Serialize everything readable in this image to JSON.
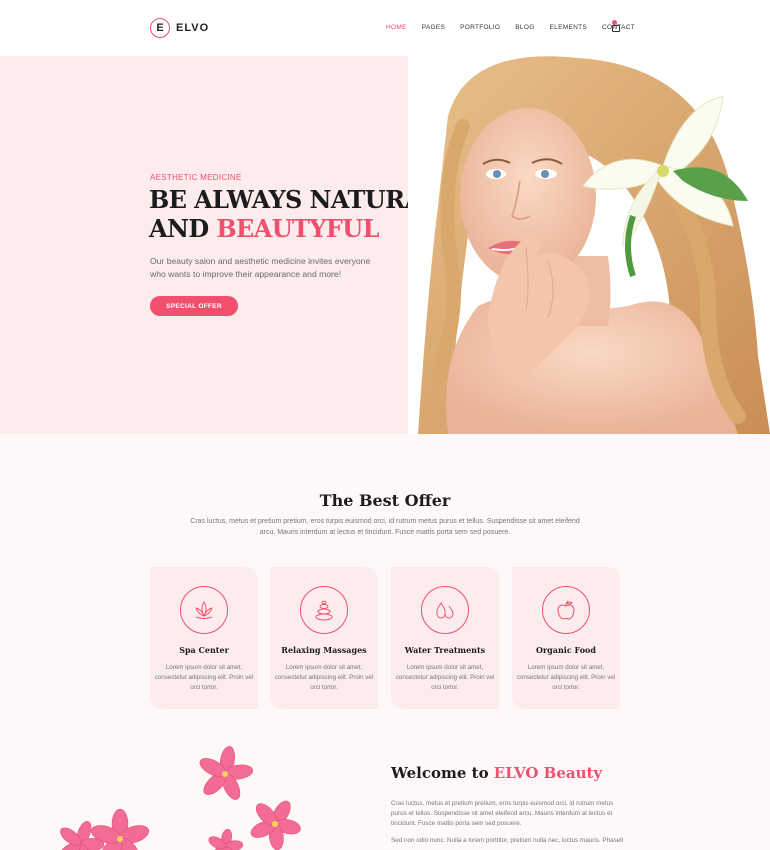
{
  "brand": {
    "logo_letter": "E",
    "name": "ELVO",
    "accent_color": "#f0506e"
  },
  "nav": {
    "items": [
      {
        "label": "HOME",
        "active": true
      },
      {
        "label": "PAGES"
      },
      {
        "label": "PORTFOLIO"
      },
      {
        "label": "BLOG"
      },
      {
        "label": "ELEMENTS"
      },
      {
        "label": "CONTACT"
      }
    ],
    "cart_icon": "shopping-bag-icon"
  },
  "hero": {
    "eyebrow": "AESTHETIC MEDICINE",
    "title_line1": "BE ALWAYS NATURAL",
    "title_line2_plain": "AND ",
    "title_line2_accent": "BEAUTYFUL",
    "description": "Our beauty salon and aesthetic medicine invites everyone who wants to improve their appearance and more!",
    "button_label": "SPECIAL OFFER",
    "image": "woman-with-lily-portrait"
  },
  "offer": {
    "title": "The Best Offer",
    "description": "Cras luctus, metus et pretium pretium, eros turpis euismod orci, id rutrum metus purus et tellus. Suspendisse sit amet eleifend arcu. Mauris interdum at lectus et tincidunt. Fusce mattis porta sem sed posuere.",
    "cards": [
      {
        "title": "Spa Center",
        "icon": "lotus-icon",
        "text": "Lorem ipsum dolor sit amet, consectetur adipiscing elit. Proin vel orci tortor."
      },
      {
        "title": "Relaxing Massages",
        "icon": "stones-icon",
        "text": "Lorem ipsum dolor sit amet, consectetur adipiscing elit. Proin vel orci tortor."
      },
      {
        "title": "Water Treatments",
        "icon": "water-drops-icon",
        "text": "Lorem ipsum dolor sit amet, consectetur adipiscing elit. Proin vel orci tortor."
      },
      {
        "title": "Organic Food",
        "icon": "apple-icon",
        "text": "Lorem ipsum dolor sit amet, consectetur adipiscing elit. Proin vel orci tortor."
      }
    ]
  },
  "welcome": {
    "title_plain": "Welcome to ",
    "title_accent": "ELVO Beauty",
    "paragraph1": "Cras luctus, metus et pretium pretium, eros turpis euismod orci, id rutrum metus purus et tellus. Suspendisse sit amet eleifend arcu. Mauris interdum at lectus et tincidunt. Fusce mattis porta sem sed posuere.",
    "paragraph2": "Sed non odio nunc. Nulla a lorem porttitor, pretium nulla nec, luctus mauris. Phasellus",
    "image": "pink-frangipani-flowers"
  }
}
